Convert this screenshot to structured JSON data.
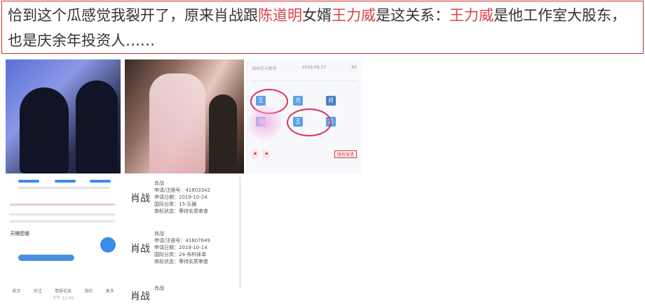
{
  "article": {
    "segments": [
      {
        "text": "恰到这个瓜感觉我裂开了，原来肖战跟",
        "highlight": false
      },
      {
        "text": "陈道明",
        "highlight": true
      },
      {
        "text": "女婿",
        "highlight": false
      },
      {
        "text": "王力威",
        "highlight": true
      },
      {
        "text": "是这关系：",
        "highlight": false
      },
      {
        "text": "王力威",
        "highlight": true
      },
      {
        "text": "是他工作室大股东，",
        "highlight": false
      },
      {
        "text": "也是庆余年投资人……",
        "highlight": false
      }
    ]
  },
  "tile3": {
    "stats": [
      "300万人民币",
      "2019.09.17",
      "63"
    ],
    "nodes": [
      "王",
      "方",
      "肖",
      "向",
      "王",
      "方"
    ],
    "stock_tag": "股权穿透"
  },
  "tile4": {
    "section": "天眼图谱",
    "nav": [
      "首页",
      "关注",
      "情报信息",
      "我的",
      "更多"
    ],
    "time": "下午 12:45"
  },
  "tile5": {
    "items": [
      {
        "name": "肖战",
        "reg_no": "申请/注册号：41803342",
        "date": "申请日期：2019-10-14",
        "class": "国际分类：15-乐器",
        "status": "商标状态：等待实质审查"
      },
      {
        "name": "肖战",
        "reg_no": "申请/注册号：41607649",
        "date": "申请日期：2019-10-14",
        "class": "国际分类：24-布料床单",
        "status": "商标状态：等待实质审查"
      },
      {
        "name": "肖战",
        "reg_no": "",
        "date": "",
        "class": "",
        "status": ""
      }
    ]
  }
}
